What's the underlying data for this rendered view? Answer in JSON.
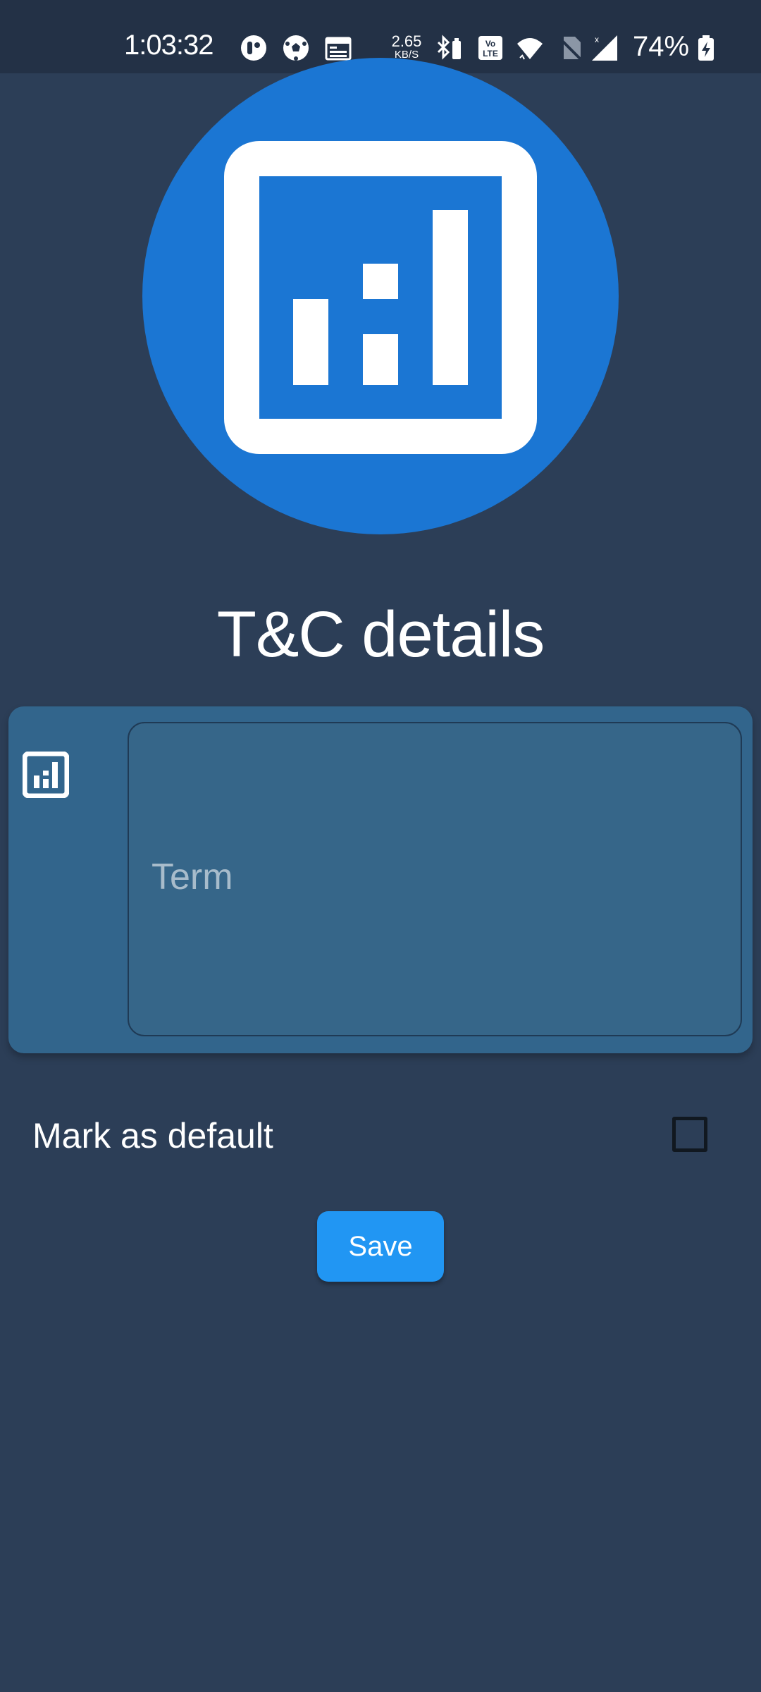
{
  "status_bar": {
    "time": "1:03:32",
    "net_speed_value": "2.65",
    "net_speed_unit": "KB/S",
    "battery": "74%",
    "icons": [
      "notification-app-icon",
      "soccer-ball-icon",
      "calendar-icon",
      "bluetooth-battery-icon",
      "volte-icon",
      "wifi-icon",
      "no-sim-icon",
      "signal-icon",
      "battery-charging-icon"
    ]
  },
  "hero": {
    "icon": "bar-chart-box-icon",
    "colors": {
      "circle": "#1b76d3",
      "glyph": "#ffffff"
    }
  },
  "page": {
    "title": "T&C details"
  },
  "form": {
    "term_icon": "bar-chart-box-icon",
    "term_placeholder": "Term",
    "default_label": "Mark as default",
    "default_checked": false,
    "save_label": "Save"
  },
  "colors": {
    "background": "#2c3e57",
    "status_bar": "#233146",
    "card": "#32658c",
    "accent": "#2196f3"
  }
}
